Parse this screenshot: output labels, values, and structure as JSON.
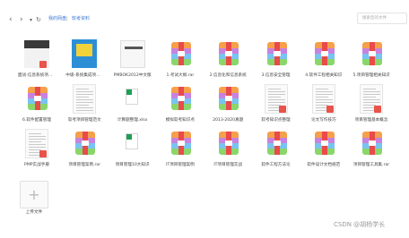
{
  "toolbar": {
    "back": "‹",
    "forward": "›",
    "dropdown": "▾",
    "refresh": "↻",
    "breadcrumb": [
      "我的网盘",
      "软考资料"
    ],
    "search_placeholder": "搜索您的文件"
  },
  "files": [
    {
      "name": "面试-信息系统项目管理师",
      "kind": "cover-a",
      "pdf": true
    },
    {
      "name": "中级-系统集成项目管理工程师",
      "kind": "cover-b",
      "pdf": false
    },
    {
      "name": "PMBOK2012中文版",
      "kind": "cover-c",
      "pdf": false
    },
    {
      "name": "1.考试大纲.rar",
      "kind": "rar",
      "pdf": false
    },
    {
      "name": "2.信息化和信息系统",
      "kind": "rar",
      "pdf": false
    },
    {
      "name": "3.信息安全管理",
      "kind": "rar",
      "pdf": false
    },
    {
      "name": "4.软件工程相关知识",
      "kind": "rar",
      "pdf": false
    },
    {
      "name": "5.项目管理相关知识",
      "kind": "rar",
      "pdf": false
    },
    {
      "name": "6.软件配置管理",
      "kind": "rar",
      "pdf": false
    },
    {
      "name": "软考项目管理范文",
      "kind": "doc",
      "pdf": false
    },
    {
      "name": "计算题整理.xlsx",
      "kind": "xls",
      "pdf": false
    },
    {
      "name": "模拟软考知识点",
      "kind": "rar",
      "pdf": false
    },
    {
      "name": "2013-2020真题",
      "kind": "rar",
      "pdf": false
    },
    {
      "name": "软考知识点整理",
      "kind": "doc",
      "pdf": true
    },
    {
      "name": "论文写作技巧",
      "kind": "doc",
      "pdf": true
    },
    {
      "name": "项目管理基本概念",
      "kind": "doc",
      "pdf": true
    },
    {
      "name": "PMP实战手册",
      "kind": "doc",
      "pdf": true
    },
    {
      "name": "项目管理案例.rar",
      "kind": "rar",
      "pdf": false
    },
    {
      "name": "项目管理10大知识",
      "kind": "xls",
      "pdf": false
    },
    {
      "name": "IT项目管理案例",
      "kind": "rar",
      "pdf": false
    },
    {
      "name": "IT项目管理实战",
      "kind": "rar",
      "pdf": false
    },
    {
      "name": "软件工程方法论",
      "kind": "rar",
      "pdf": false
    },
    {
      "name": "软件设计文档规范",
      "kind": "rar",
      "pdf": false
    },
    {
      "name": "项目管理工具集.rar",
      "kind": "rar",
      "pdf": false
    }
  ],
  "upload_label": "上传文件",
  "watermark": "CSDN @胡杨学长"
}
